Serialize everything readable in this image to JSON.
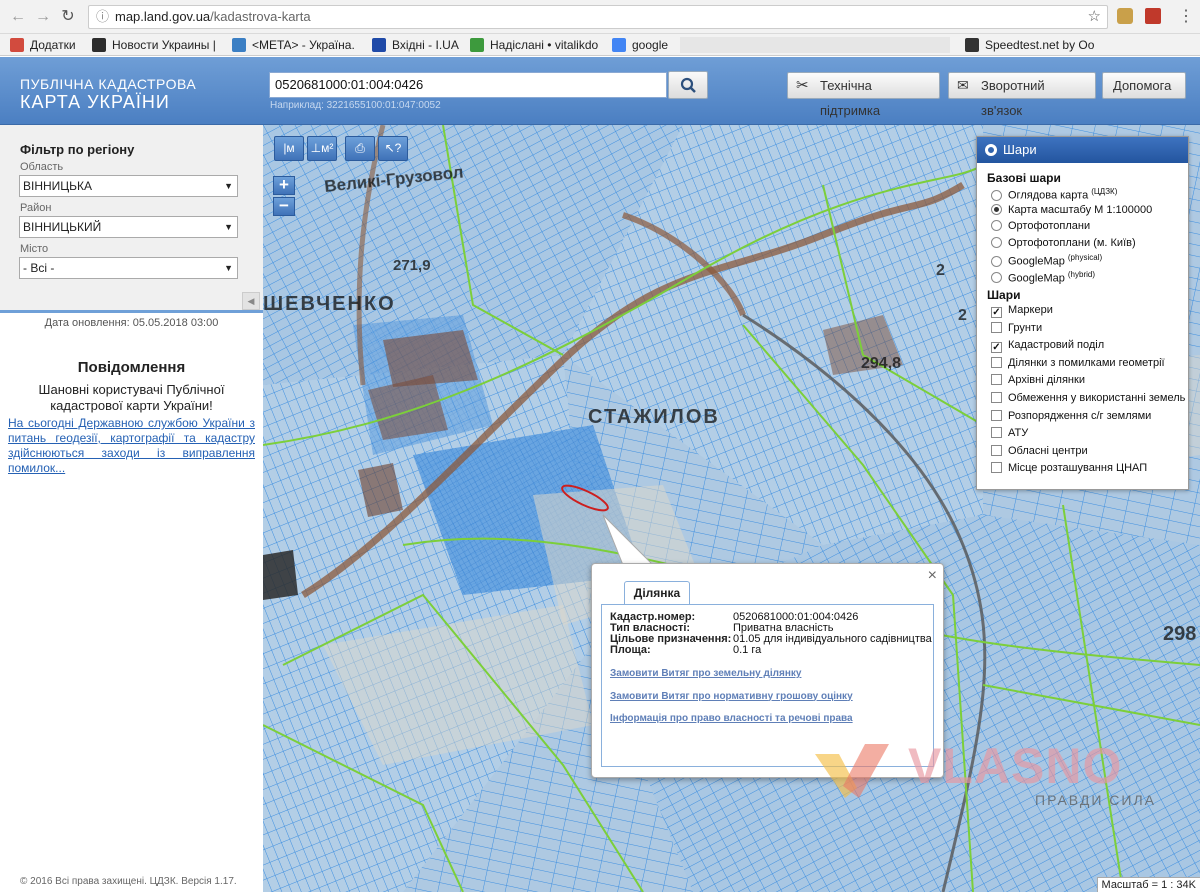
{
  "browser": {
    "url_host": "map.land.gov.ua",
    "url_path": "/kadastrova-karta",
    "bookmarks": [
      {
        "label": "Додатки",
        "icon": "apps-icon",
        "color": "#d24b3e"
      },
      {
        "label": "Новости Украины |",
        "icon": "news-icon",
        "color": "#2d2d2d"
      },
      {
        "label": "<META> - Україна.",
        "icon": "meta-icon",
        "color": "#3b7fc4"
      },
      {
        "label": "Вхідні - I.UA",
        "icon": "iua-icon",
        "color": "#1f4aa8"
      },
      {
        "label": "Надіслані • vitalikdo",
        "icon": "mail-icon",
        "color": "#3d9a3d"
      },
      {
        "label": "google",
        "icon": "google-icon",
        "color": "#4285f4"
      },
      {
        "label": "Speedtest.net by Oo",
        "icon": "speedtest-icon",
        "color": "#333333"
      }
    ]
  },
  "header": {
    "brand_line1": "ПУБЛІЧНА КАДАСТРОВА",
    "brand_line2": "КАРТА УКРАЇНИ",
    "search_value": "0520681000:01:004:0426",
    "search_example": "Наприклад: 3221655100:01:047:0052",
    "buttons": {
      "support": "Технічна підтримка",
      "feedback": "Зворотний зв'язок",
      "help": "Допомога"
    }
  },
  "sidebar": {
    "filter_title": "Фільтр по регіону",
    "oblast_label": "Область",
    "oblast_value": "ВІННИЦЬКА",
    "raion_label": "Район",
    "raion_value": "ВІННИЦЬКИЙ",
    "city_label": "Місто",
    "city_value": "- Всі -",
    "updated": "Дата оновлення: 05.05.2018 03:00",
    "message_title": "Повідомлення",
    "message_body_1": "Шановні користувачі Публічної",
    "message_body_2": "кадастрової карти України!",
    "message_link": "На сьогодні Державною службою України з питань геодезії, картографії та кадастру здійснюються заходи із виправлення помилок...",
    "copyright": "© 2016 Всі права захищені. ЦДЗК. Версія 1.17."
  },
  "map": {
    "tools": [
      "|м",
      "⊥м²",
      "⎙",
      "↖?"
    ],
    "zoom_in": "+",
    "zoom_out": "−",
    "scale": "Масштаб = 1 : 34K",
    "labels": [
      {
        "text": "Великі-Грузовол"
      },
      {
        "text": "271,9"
      },
      {
        "text": "ШЕВЧЕНКО"
      },
      {
        "text": "СТАЖИЛОВ"
      },
      {
        "text": "294,8"
      },
      {
        "text": "2"
      },
      {
        "text": "2"
      },
      {
        "text": "298"
      }
    ]
  },
  "layers": {
    "title": "Шари",
    "base_title": "Базові шари",
    "base": [
      {
        "label": "Оглядова карта",
        "sup": "(ЦДЗК)",
        "on": false
      },
      {
        "label": "Карта масштабу М 1:100000",
        "sup": "",
        "on": true
      },
      {
        "label": "Ортофотоплани",
        "sup": "",
        "on": false
      },
      {
        "label": "Ортофотоплани (м. Київ)",
        "sup": "",
        "on": false
      },
      {
        "label": "GoogleMap",
        "sup": "(physical)",
        "on": false
      },
      {
        "label": "GoogleMap",
        "sup": "(hybrid)",
        "on": false
      }
    ],
    "overlay_title": "Шари",
    "overlays": [
      {
        "label": "Маркери",
        "on": true
      },
      {
        "label": "Грунти",
        "on": false
      },
      {
        "label": "Кадастровий поділ",
        "on": true
      },
      {
        "label": "Ділянки з помилками геометрії",
        "on": false
      },
      {
        "label": "Архівні ділянки",
        "on": false
      },
      {
        "label": "Обмеження у використанні земель",
        "on": false
      },
      {
        "label": "Розпорядження с/г землями",
        "on": false
      },
      {
        "label": "АТУ",
        "on": false
      },
      {
        "label": "Обласні центри",
        "on": false
      },
      {
        "label": "Місце розташування ЦНАП",
        "on": false
      }
    ]
  },
  "popup": {
    "tab": "Ділянка",
    "close": "×",
    "rows": [
      {
        "key": "Кадастр.номер:",
        "value": "0520681000:01:004:0426"
      },
      {
        "key": "Тип власності:",
        "value": "Приватна власність"
      },
      {
        "key": "Цільове призначення:",
        "value": "01.05 для індивідуального садівництва"
      },
      {
        "key": "Площа:",
        "value": "0.1 га"
      }
    ],
    "links": [
      "Замовити Витяг про земельну ділянку",
      "Замовити Витяг про нормативну грошову оцінку",
      "Інформація про право власності та речові права"
    ]
  },
  "watermark": {
    "word": "VLASNO",
    "tagline": "ПРАВДИ СИЛА"
  },
  "colors": {
    "header_blue": "#4b7fc2",
    "parcel_blue": "#3e8fe0",
    "boundary_green": "#7ccf3a",
    "road_brown": "#8b5a3c",
    "selection_red": "#cc1f1f"
  }
}
